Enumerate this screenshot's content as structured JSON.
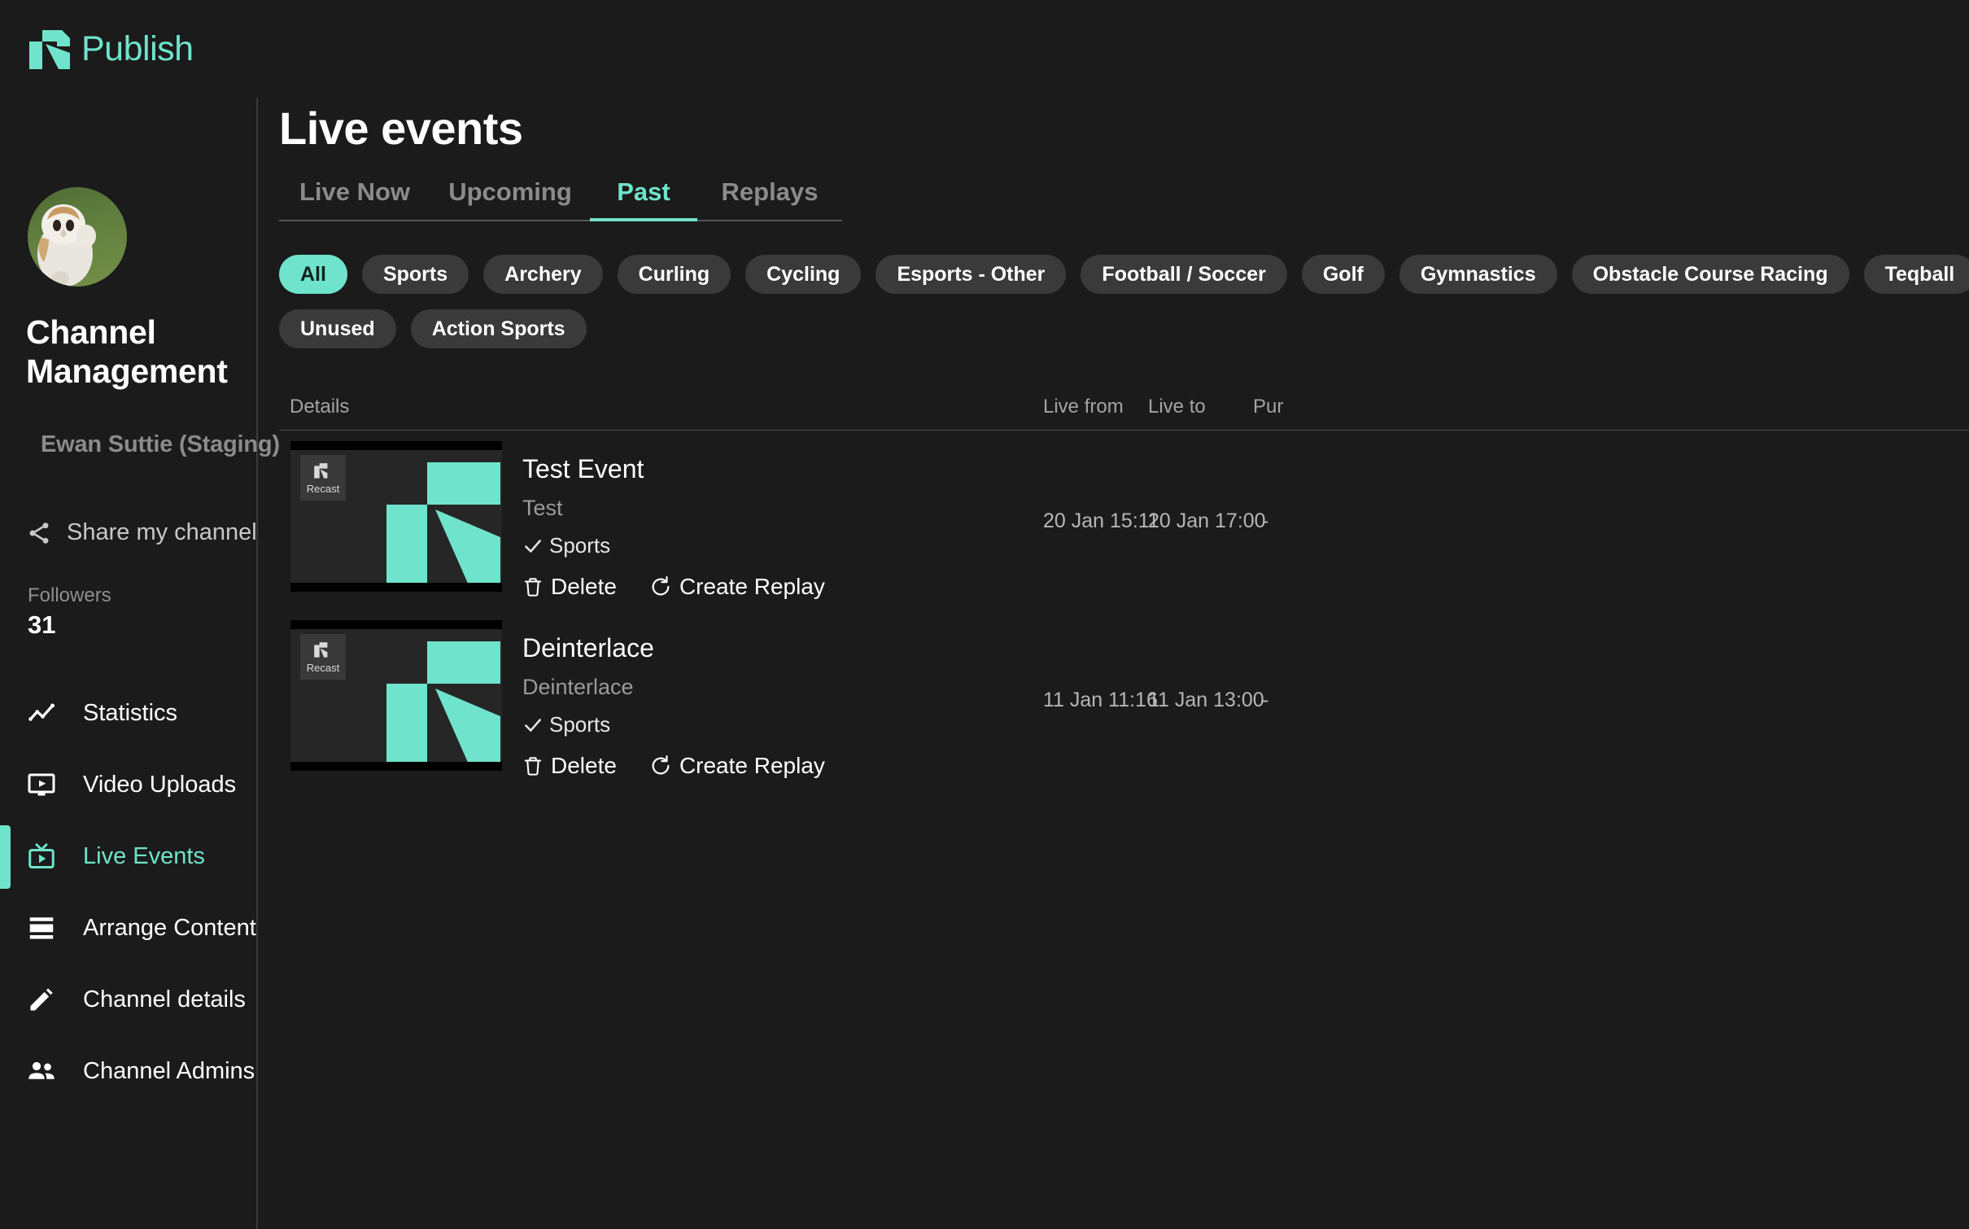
{
  "brand": {
    "name": "Publish",
    "accent": "#6fe3cb",
    "logo_icon": "recast-logo-icon"
  },
  "sidebar": {
    "avatar_alt": "owl-avatar",
    "channel_name": "Channel Management",
    "channel_owner": "Ewan Suttie (Staging)",
    "share": {
      "label": "Share my channel",
      "icon": "share-icon"
    },
    "followers_label": "Followers",
    "followers_count": "31",
    "nav": [
      {
        "label": "Statistics",
        "icon": "trending-line-icon",
        "active": false
      },
      {
        "label": "Video Uploads",
        "icon": "video-monitor-icon",
        "active": false
      },
      {
        "label": "Live Events",
        "icon": "tv-play-icon",
        "active": true
      },
      {
        "label": "Arrange Content",
        "icon": "rows-layout-icon",
        "active": false
      },
      {
        "label": "Channel details",
        "icon": "pencil-icon",
        "active": false
      },
      {
        "label": "Channel Admins",
        "icon": "people-icon",
        "active": false
      }
    ]
  },
  "main": {
    "title": "Live events",
    "tabs": [
      {
        "label": "Live Now",
        "active": false
      },
      {
        "label": "Upcoming",
        "active": false
      },
      {
        "label": "Past",
        "active": true
      },
      {
        "label": "Replays",
        "active": false
      }
    ],
    "chips": [
      {
        "label": "All",
        "active": true
      },
      {
        "label": "Sports",
        "active": false
      },
      {
        "label": "Archery",
        "active": false
      },
      {
        "label": "Curling",
        "active": false
      },
      {
        "label": "Cycling",
        "active": false
      },
      {
        "label": "Esports - Other",
        "active": false
      },
      {
        "label": "Football / Soccer",
        "active": false
      },
      {
        "label": "Golf",
        "active": false
      },
      {
        "label": "Gymnastics",
        "active": false
      },
      {
        "label": "Obstacle Course Racing",
        "active": false
      },
      {
        "label": "Teqball",
        "active": false
      },
      {
        "label": "Unused",
        "active": false
      },
      {
        "label": "Action Sports",
        "active": false
      }
    ],
    "table": {
      "headers": {
        "details": "Details",
        "live_from": "Live from",
        "live_to": "Live to",
        "purchases": "Pur"
      },
      "rows": [
        {
          "thumbnail_watermark": "Recast",
          "title": "Test Event",
          "subtitle": "Test",
          "category": "Sports",
          "category_icon": "check-icon",
          "delete_label": "Delete",
          "delete_icon": "trash-icon",
          "replay_label": "Create Replay",
          "replay_icon": "refresh-icon",
          "live_from": "20 Jan 15:11",
          "live_to": "20 Jan 17:00",
          "purchases": "-"
        },
        {
          "thumbnail_watermark": "Recast",
          "title": "Deinterlace",
          "subtitle": "Deinterlace",
          "category": "Sports",
          "category_icon": "check-icon",
          "delete_label": "Delete",
          "delete_icon": "trash-icon",
          "replay_label": "Create Replay",
          "replay_icon": "refresh-icon",
          "live_from": "11 Jan 11:16",
          "live_to": "11 Jan 13:00",
          "purchases": "-"
        }
      ]
    }
  }
}
